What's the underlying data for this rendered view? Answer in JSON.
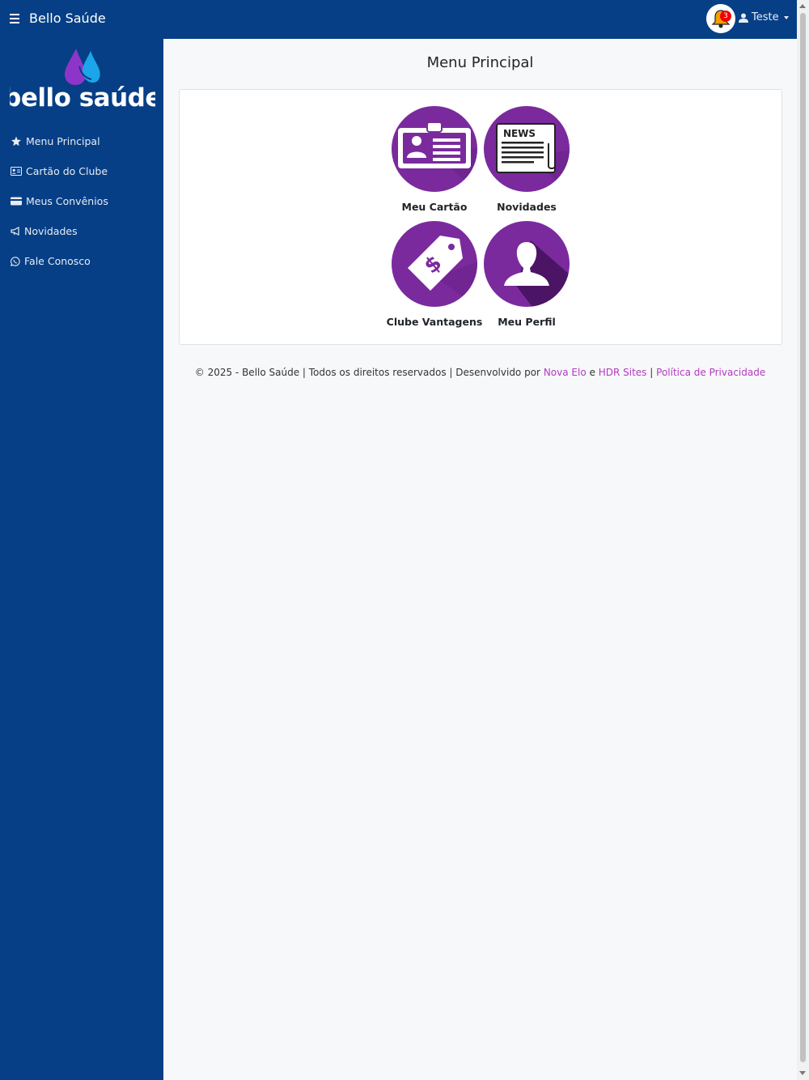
{
  "topbar": {
    "brand": "Bello Saúde",
    "notifications_count": "3",
    "user_name": "Teste"
  },
  "sidebar": {
    "logo_text": "bello saúde",
    "items": [
      {
        "label": "Menu Principal",
        "icon": "star-icon"
      },
      {
        "label": "Cartão do Clube",
        "icon": "id-card-icon"
      },
      {
        "label": "Meus Convênios",
        "icon": "credit-card-icon"
      },
      {
        "label": "Novidades",
        "icon": "megaphone-icon"
      },
      {
        "label": "Fale Conosco",
        "icon": "whatsapp-icon"
      }
    ]
  },
  "main": {
    "title": "Menu Principal",
    "tiles": [
      {
        "label": "Meu Cartão",
        "icon": "id-card-icon"
      },
      {
        "label": "Novidades",
        "icon": "newspaper-icon"
      },
      {
        "label": "Clube Vantagens",
        "icon": "price-tag-icon"
      },
      {
        "label": "Meu Perfil",
        "icon": "user-silhouette-icon"
      }
    ],
    "news_icon_text": "NEWS"
  },
  "footer": {
    "text": "© 2025 - Bello Saúde | Todos os direitos reservados | Desenvolvido por",
    "link1": "Nova Elo",
    "conj": "e",
    "link2": "HDR Sites",
    "sep": "|",
    "link3": "Política de Privacidade"
  },
  "colors": {
    "primary": "#063f86",
    "tile": "#7b2a9e",
    "link": "#b23bbf",
    "badge": "#e00000"
  }
}
